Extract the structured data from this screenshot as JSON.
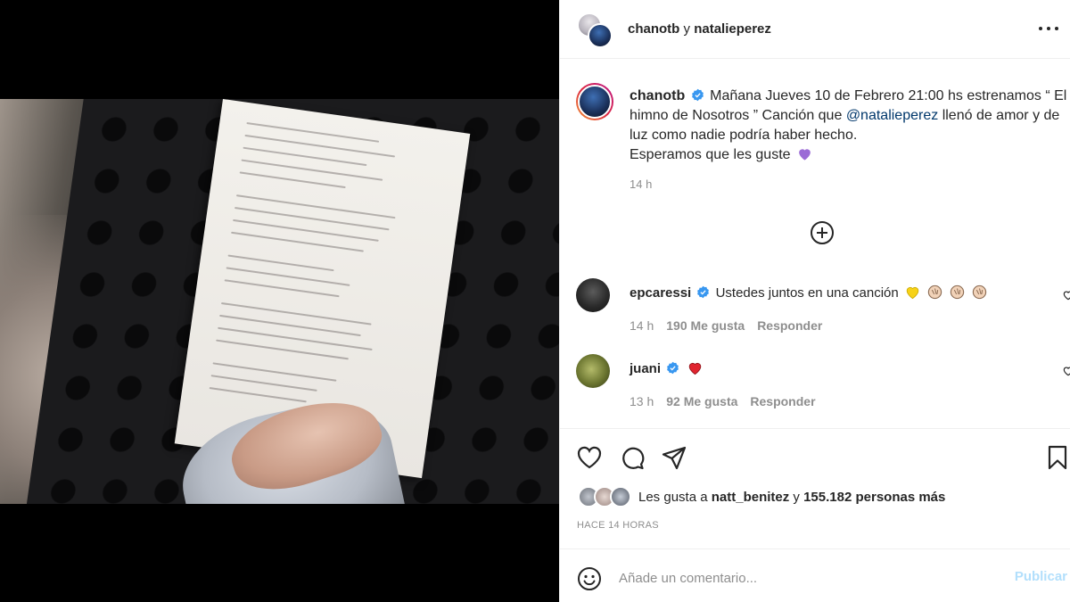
{
  "header": {
    "user1": "chanotb",
    "joiner": "y",
    "user2": "natalieperez"
  },
  "caption": {
    "username": "chanotb",
    "text_part1": "Mañana Jueves 10 de Febrero 21:00 hs estrenamos “ El himno de Nosotros ” Canción que",
    "mention": "@natalieperez",
    "text_part2": "llenó de amor y de luz como nadie podría haber hecho.",
    "line2": "Esperamos que les guste",
    "time": "14 h"
  },
  "comments": [
    {
      "username": "epcaressi",
      "text": "Ustedes juntos en una canción",
      "emoji": [
        "yellow-heart",
        "clap",
        "clap",
        "clap"
      ],
      "time": "14 h",
      "likes": "190 Me gusta",
      "reply": "Responder"
    },
    {
      "username": "juani",
      "text": "",
      "emoji": [
        "red-heart"
      ],
      "time": "13 h",
      "likes": "92 Me gusta",
      "reply": "Responder"
    }
  ],
  "likes": {
    "prefix": "Les gusta a",
    "user": "natt_benitez",
    "joiner": "y",
    "others": "155.182 personas más"
  },
  "posted": "HACE 14 HORAS",
  "composer": {
    "placeholder": "Añade un comentario...",
    "publish": "Publicar"
  },
  "carousel": {
    "count": 4,
    "active": 4
  },
  "colors": {
    "accent": "#0095f6",
    "publish_disabled": "#b2dffc",
    "verified": "#3897f0",
    "mention": "#00376b"
  },
  "icons": [
    "more-icon",
    "verified-icon",
    "add-circle-icon",
    "heart-icon",
    "comment-icon",
    "share-icon",
    "bookmark-icon",
    "smile-icon"
  ]
}
